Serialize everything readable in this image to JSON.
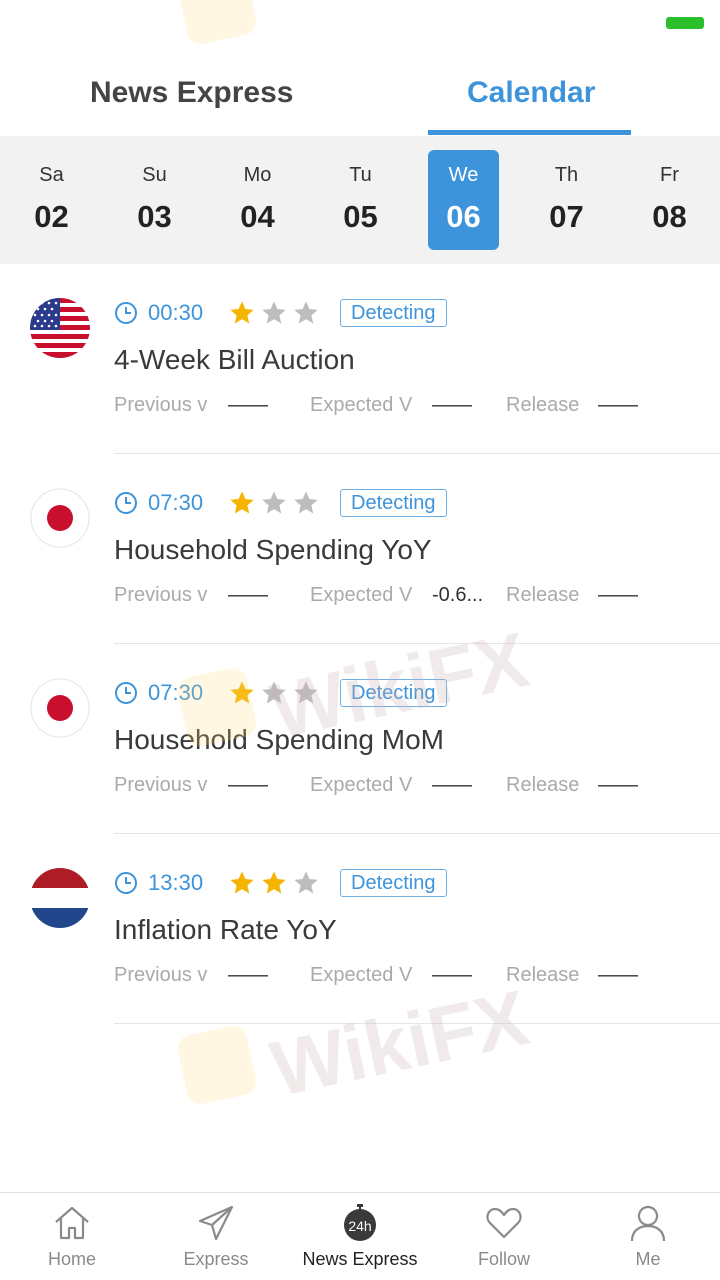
{
  "tabs": {
    "news": "News Express",
    "calendar": "Calendar"
  },
  "days": [
    {
      "name": "Sa",
      "num": "02"
    },
    {
      "name": "Su",
      "num": "03"
    },
    {
      "name": "Mo",
      "num": "04"
    },
    {
      "name": "Tu",
      "num": "05"
    },
    {
      "name": "We",
      "num": "06"
    },
    {
      "name": "Th",
      "num": "07"
    },
    {
      "name": "Fr",
      "num": "08"
    }
  ],
  "events": [
    {
      "country_flag": "us-flag",
      "time": "00:30",
      "stars": 1,
      "status": "Detecting",
      "title": "4-Week Bill Auction",
      "previous_label": "Previous v",
      "previous_value": "——",
      "expected_label": "Expected V",
      "expected_value": "——",
      "release_label": "Release",
      "release_value": "——"
    },
    {
      "country_flag": "japan-flag",
      "time": "07:30",
      "stars": 1,
      "status": "Detecting",
      "title": "Household Spending YoY",
      "previous_label": "Previous v",
      "previous_value": "——",
      "expected_label": "Expected V",
      "expected_value": "-0.6...",
      "release_label": "Release",
      "release_value": "——"
    },
    {
      "country_flag": "japan-flag",
      "time": "07:30",
      "stars": 1,
      "status": "Detecting",
      "title": "Household Spending MoM",
      "previous_label": "Previous v",
      "previous_value": "——",
      "expected_label": "Expected V",
      "expected_value": "——",
      "release_label": "Release",
      "release_value": "——"
    },
    {
      "country_flag": "netherlands-flag",
      "time": "13:30",
      "stars": 2,
      "status": "Detecting",
      "title": "Inflation Rate YoY",
      "previous_label": "Previous v",
      "previous_value": "——",
      "expected_label": "Expected V",
      "expected_value": "——",
      "release_label": "Release",
      "release_value": "——"
    }
  ],
  "watermark": "WikiFX",
  "nav": {
    "home": "Home",
    "express": "Express",
    "news_express": "News Express",
    "news_badge": "24h",
    "follow": "Follow",
    "me": "Me"
  },
  "colors": {
    "accent": "#3d94db",
    "star_on": "#f5b400",
    "star_off": "#bdbdbd"
  }
}
